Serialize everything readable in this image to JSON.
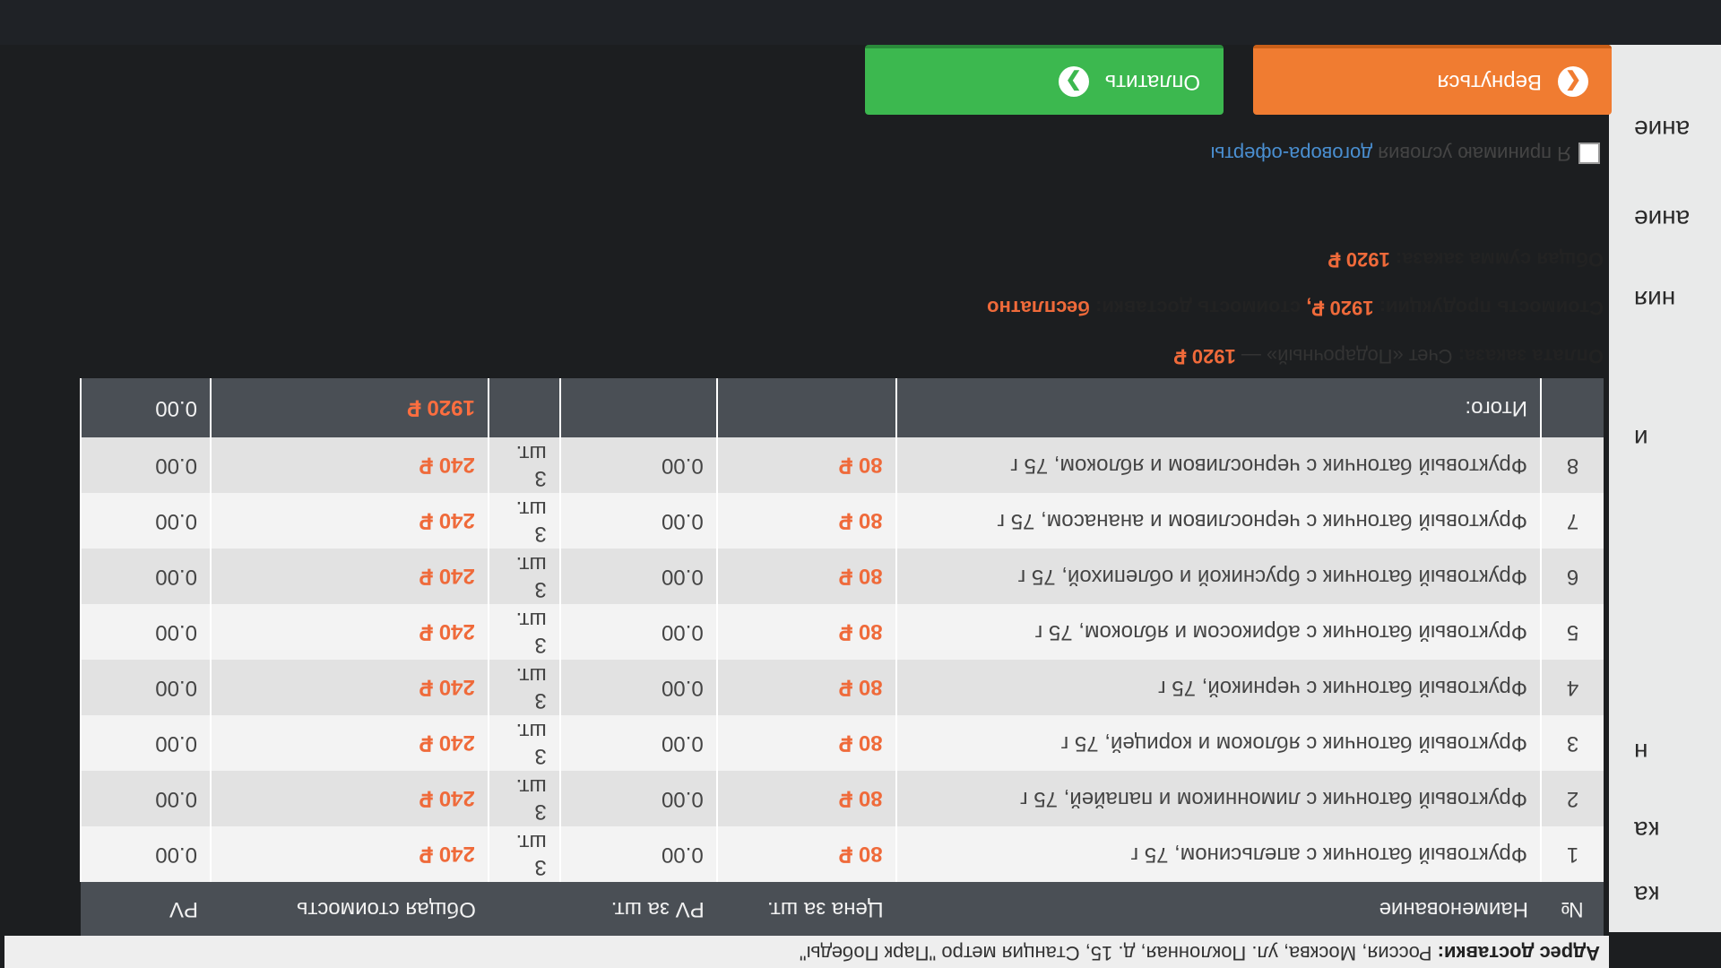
{
  "sidebar": {
    "fragments": [
      "ка",
      "ка",
      "н",
      "и",
      "ния",
      "ание",
      "ание"
    ]
  },
  "address": {
    "label": "Адрес доставки:",
    "value": "Россия, Москва, ул. Поклонная, д. 15, Станция метро \"Парк Победы\""
  },
  "table": {
    "headers": [
      "№",
      "Наименование",
      "Цена за шт.",
      "PV за шт.",
      "",
      "Общая стоимость",
      "PV"
    ],
    "rows": [
      {
        "num": "1",
        "name": "Фруктовый батончик с апельсином, 75 г",
        "price": "80 ₽",
        "pv": "0.00",
        "qty": "3 шт.",
        "total": "240 ₽",
        "pv_total": "0.00"
      },
      {
        "num": "2",
        "name": "Фруктовый батончик с лимонником и папайей, 75 г",
        "price": "80 ₽",
        "pv": "0.00",
        "qty": "3 шт.",
        "total": "240 ₽",
        "pv_total": "0.00"
      },
      {
        "num": "3",
        "name": "Фруктовый батончик с яблоком и корицей, 75 г",
        "price": "80 ₽",
        "pv": "0.00",
        "qty": "3 шт.",
        "total": "240 ₽",
        "pv_total": "0.00"
      },
      {
        "num": "4",
        "name": "Фруктовый батончик с черникой, 75 г",
        "price": "80 ₽",
        "pv": "0.00",
        "qty": "3 шт.",
        "total": "240 ₽",
        "pv_total": "0.00"
      },
      {
        "num": "5",
        "name": "Фруктовый батончик с абрикосом и яблоком, 75 г",
        "price": "80 ₽",
        "pv": "0.00",
        "qty": "3 шт.",
        "total": "240 ₽",
        "pv_total": "0.00"
      },
      {
        "num": "6",
        "name": "Фруктовый батончик с брусникой и облепихой, 75 г",
        "price": "80 ₽",
        "pv": "0.00",
        "qty": "3 шт.",
        "total": "240 ₽",
        "pv_total": "0.00"
      },
      {
        "num": "7",
        "name": "Фруктовый батончик с черносливом и ананасом, 75 г",
        "price": "80 ₽",
        "pv": "0.00",
        "qty": "3 шт.",
        "total": "240 ₽",
        "pv_total": "0.00"
      },
      {
        "num": "8",
        "name": "Фруктовый батончик с черносливом и яблоком, 75 г",
        "price": "80 ₽",
        "pv": "0.00",
        "qty": "3 шт.",
        "total": "240 ₽",
        "pv_total": "0.00"
      }
    ],
    "total": {
      "label": "Итого:",
      "sum": "1920 ₽",
      "pv": "0.00"
    }
  },
  "summary": {
    "payment_label": "Оплата заказа:",
    "payment_value": "Счет «Подарочный» —",
    "payment_sum": "1920 ₽",
    "products_label": "Стоимость продукции:",
    "products_sum": "1920 ₽,",
    "delivery_label": "стоимость доставки:",
    "delivery_value": "бесплатно",
    "order_total_label": "Общая сумма заказа:",
    "order_total": "1920 ₽"
  },
  "agreement": {
    "text": "Я принимаю условия",
    "link": "договора-оферты"
  },
  "buttons": {
    "back": "Вернуться",
    "pay": "Оплатить"
  },
  "colors": {
    "accent": "#ef6a3a",
    "header_bg": "#4a4f55",
    "back_button": "#f07c31",
    "pay_button": "#3cb84f",
    "link": "#4a8fd1"
  }
}
